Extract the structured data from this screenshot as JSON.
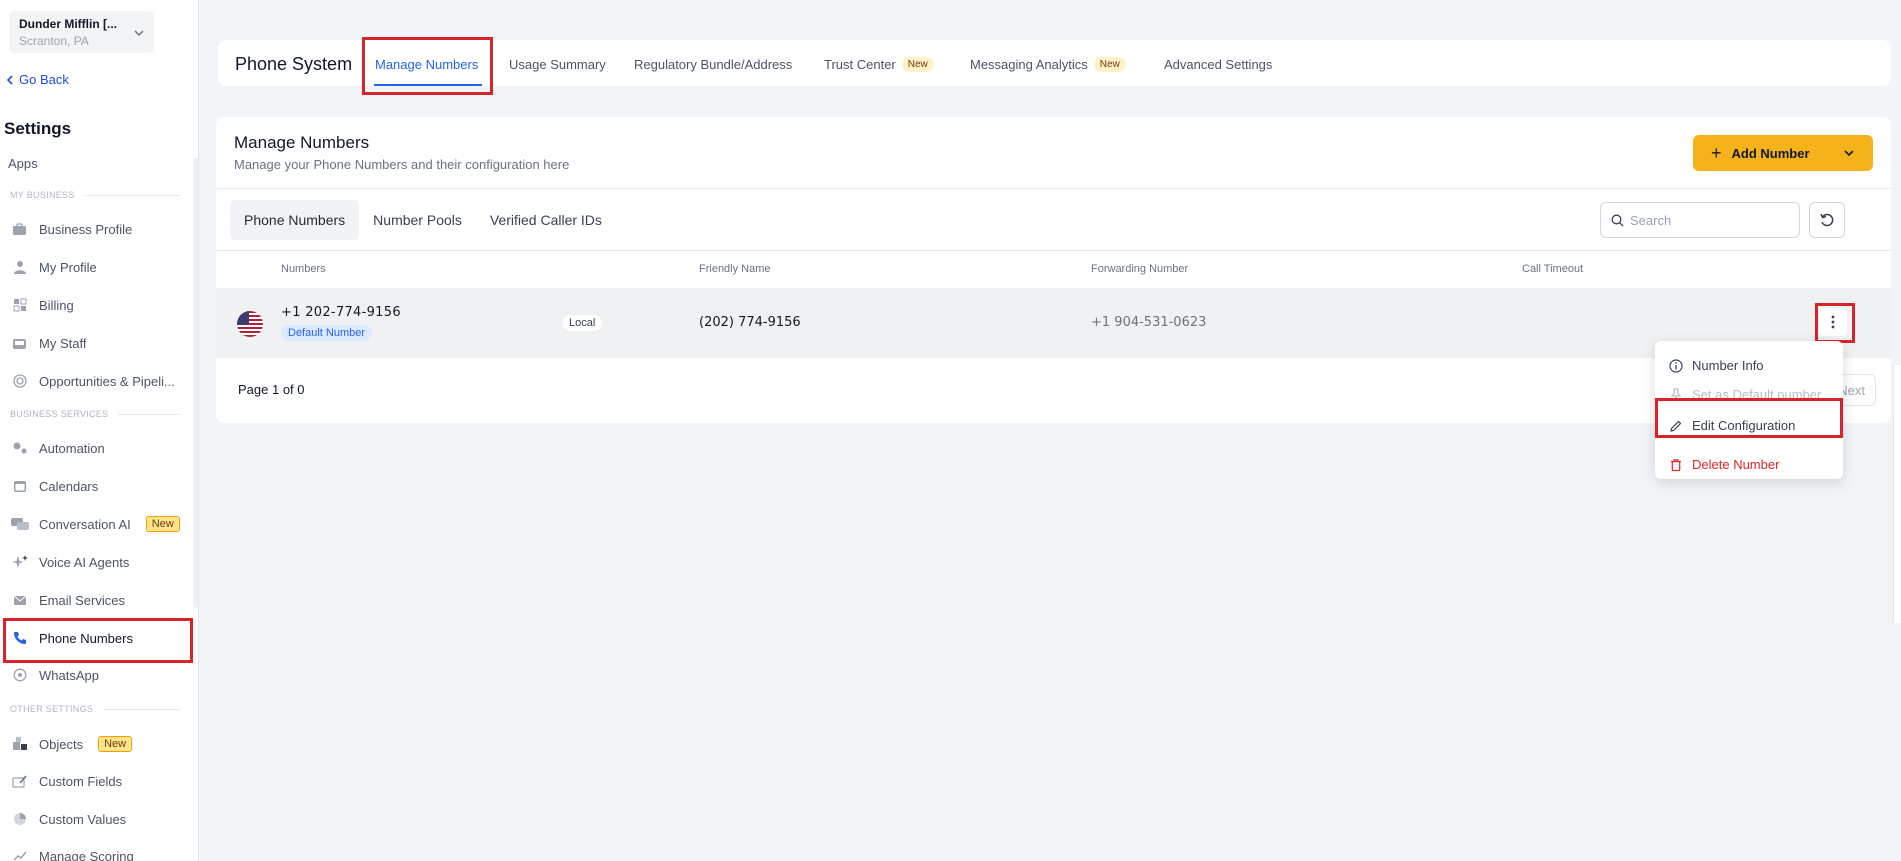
{
  "location": {
    "name": "Dunder Mifflin [...",
    "city": "Scranton, PA"
  },
  "sidebar": {
    "go_back": "Go Back",
    "title": "Settings",
    "apps": "Apps",
    "sections": [
      "MY BUSINESS",
      "BUSINESS SERVICES",
      "OTHER SETTINGS"
    ],
    "items": [
      {
        "label": "Business Profile",
        "icon": "briefcase-icon"
      },
      {
        "label": "My Profile",
        "icon": "user-icon"
      },
      {
        "label": "Billing",
        "icon": "billing-icon"
      },
      {
        "label": "My Staff",
        "icon": "staff-icon"
      },
      {
        "label": "Opportunities & Pipeli...",
        "icon": "target-icon"
      },
      {
        "label": "Automation",
        "icon": "gears-icon"
      },
      {
        "label": "Calendars",
        "icon": "calendar-icon"
      },
      {
        "label": "Conversation AI",
        "icon": "chat-icon",
        "badge": "New"
      },
      {
        "label": "Voice AI Agents",
        "icon": "sparkle-icon"
      },
      {
        "label": "Email Services",
        "icon": "envelope-icon"
      },
      {
        "label": "Phone Numbers",
        "icon": "phone-icon"
      },
      {
        "label": "WhatsApp",
        "icon": "whatsapp-icon"
      },
      {
        "label": "Objects",
        "icon": "objects-icon",
        "badge": "New"
      },
      {
        "label": "Custom Fields",
        "icon": "edit-field-icon"
      },
      {
        "label": "Custom Values",
        "icon": "pie-icon"
      },
      {
        "label": "Manage Scoring",
        "icon": "trend-icon"
      }
    ]
  },
  "topbar": {
    "title": "Phone System",
    "tabs": [
      {
        "label": "Manage Numbers"
      },
      {
        "label": "Usage Summary"
      },
      {
        "label": "Regulatory Bundle/Address"
      },
      {
        "label": "Trust Center",
        "badge": "New"
      },
      {
        "label": "Messaging Analytics",
        "badge": "New"
      },
      {
        "label": "Advanced Settings"
      }
    ]
  },
  "main": {
    "title": "Manage Numbers",
    "subtitle": "Manage your Phone Numbers and their configuration here",
    "add_button": "Add Number",
    "subtabs": [
      "Phone Numbers",
      "Number Pools",
      "Verified Caller IDs"
    ],
    "search_placeholder": "Search",
    "columns": [
      "Numbers",
      "Friendly Name",
      "Forwarding Number",
      "Call Timeout"
    ],
    "rows": [
      {
        "number": "+1 202-774-9156",
        "default_badge": "Default Number",
        "type": "Local",
        "friendly_name": "(202) 774-9156",
        "forwarding": "+1 904-531-0623",
        "timeout": ""
      }
    ],
    "pager": "Page 1 of 0",
    "next_label": "Next"
  },
  "menu": {
    "items": [
      {
        "label": "Number Info",
        "icon": "info-icon"
      },
      {
        "label": "Set as Default number",
        "icon": "pin-icon",
        "disabled": true
      },
      {
        "label": "Edit Configuration",
        "icon": "pencil-icon"
      },
      {
        "label": "Delete Number",
        "icon": "trash-icon",
        "danger": true
      }
    ]
  },
  "colors": {
    "accent": "#2563eb",
    "primary_button": "#f6b21b",
    "highlight": "#d8232a",
    "danger": "#dc2626"
  }
}
